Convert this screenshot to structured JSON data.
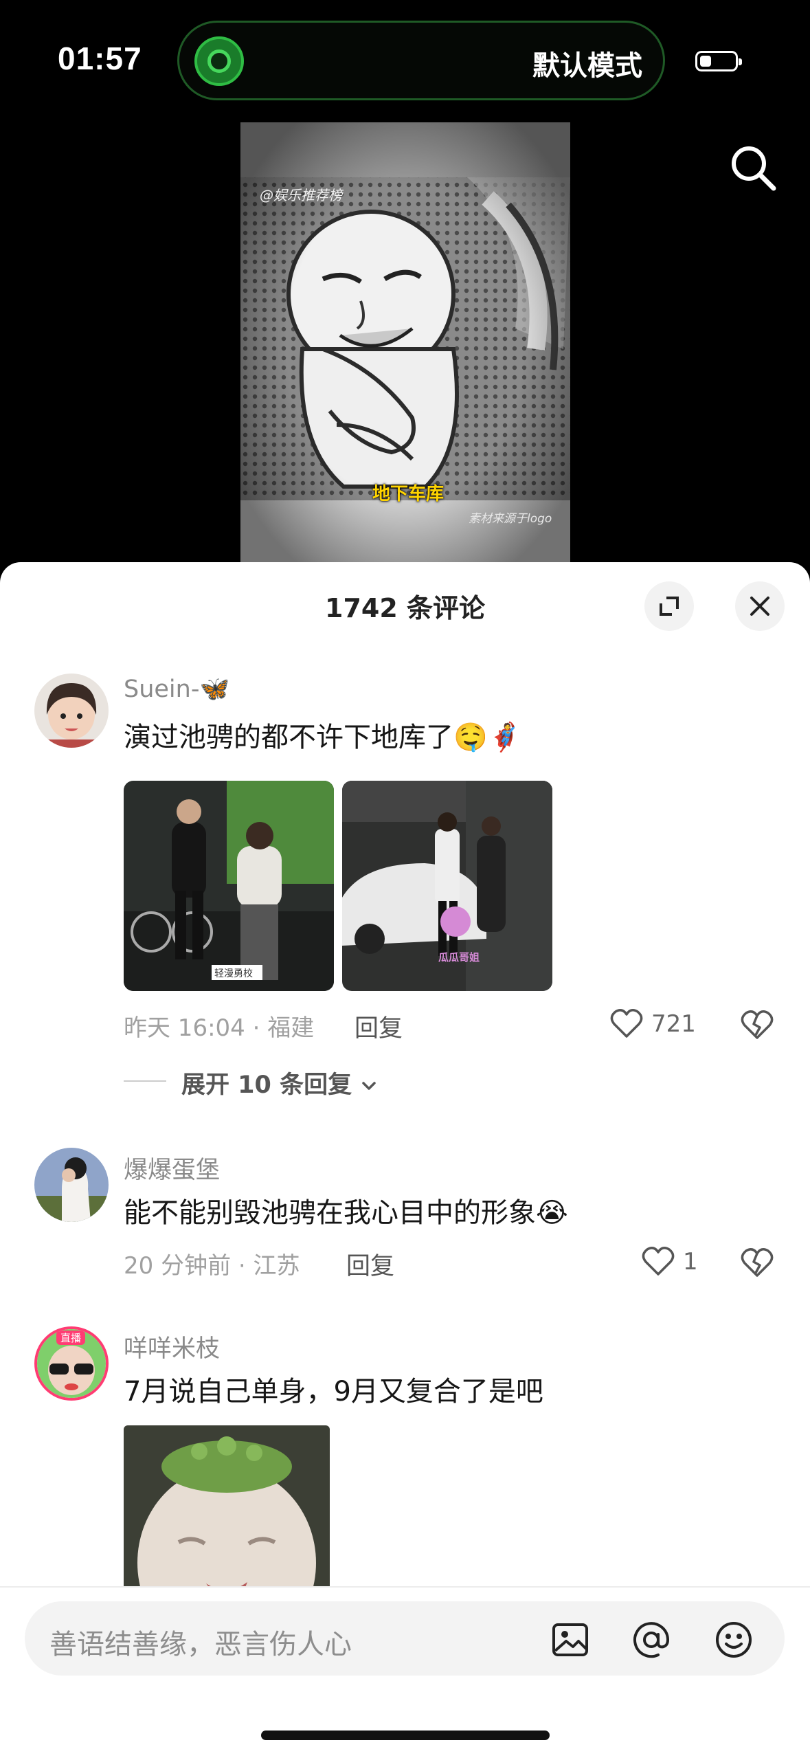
{
  "status": {
    "time": "01:57",
    "mode_label": "默认模式"
  },
  "video": {
    "watermark": "@娱乐推荐榜",
    "caption": "地下车库",
    "source_note": "素材来源于logo"
  },
  "sheet": {
    "title": "1742 条评论"
  },
  "comments": [
    {
      "username": "Suein-🦋",
      "text": "演过池骋的都不许下地库了🤤🦸",
      "meta": "昨天 16:04 · 福建",
      "reply_label": "回复",
      "likes": "721",
      "expand_label": "展开 10 条回复",
      "image_labels": [
        "轻漫勇校",
        "瓜瓜哥姐"
      ]
    },
    {
      "username": "爆爆蛋堡",
      "text": "能不能别毁池骋在我心目中的形象😭",
      "meta": "20 分钟前 · 江苏",
      "reply_label": "回复",
      "likes": "1"
    },
    {
      "username": "咩咩米枝",
      "badge": "直播",
      "text": "7月说自己单身，9月又复合了是吧"
    }
  ],
  "input": {
    "placeholder": "善语结善缘，恶言伤人心"
  },
  "icons": [
    "app-icon",
    "battery-icon",
    "search-icon",
    "expand-icon",
    "close-icon",
    "heart-icon",
    "broken-heart-icon",
    "chevron-down-icon",
    "image-icon",
    "at-icon",
    "emoji-icon"
  ]
}
